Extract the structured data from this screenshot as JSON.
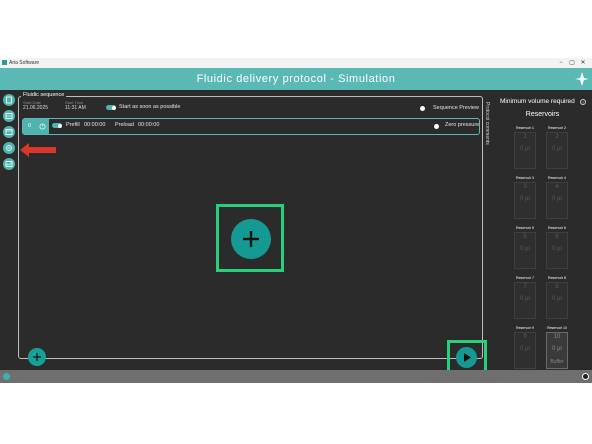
{
  "window": {
    "app_title": "Aria Software",
    "minimize_glyph": "−",
    "maximize_glyph": "▢",
    "close_glyph": "✕"
  },
  "header": {
    "title": "Fluidic delivery protocol - Simulation",
    "brand_icon": "aria-logo-icon"
  },
  "sidebar": {
    "icons": [
      "protocol-icon",
      "layers-icon",
      "calendar-icon",
      "settings-icon",
      "chart-icon"
    ]
  },
  "sequence": {
    "legend": "Fluidic sequence",
    "start_date_label": "Start Date",
    "start_date": "21.06.2025",
    "start_time_label": "Start Time",
    "start_time": "11:31 AM",
    "start_asap": "Start as soon as possible",
    "sequence_preview": "Sequence Preview",
    "row": {
      "number": "0",
      "prefill_label": "Prefill",
      "prefill_time": "00:00:00",
      "preload_label": "Preload",
      "preload_time": "00:00:00",
      "zero_pressure": "Zero pressure"
    },
    "add_glyph": "+",
    "play_glyph": "▶"
  },
  "side_tab": {
    "label": "Protocol comments"
  },
  "right_panel": {
    "min_volume_label": "Minimum volume required",
    "info_glyph": "?",
    "reservoirs_title": "Reservoirs",
    "reservoirs": [
      {
        "name": "Reservoir 1",
        "number": "1",
        "volume": "0 µl",
        "sub": ""
      },
      {
        "name": "Reservoir 2",
        "number": "2",
        "volume": "0 µl",
        "sub": ""
      },
      {
        "name": "Reservoir 3",
        "number": "3",
        "volume": "0 µl",
        "sub": ""
      },
      {
        "name": "Reservoir 4",
        "number": "4",
        "volume": "0 µl",
        "sub": ""
      },
      {
        "name": "Reservoir 5",
        "number": "5",
        "volume": "0 µl",
        "sub": ""
      },
      {
        "name": "Reservoir 6",
        "number": "6",
        "volume": "0 µl",
        "sub": ""
      },
      {
        "name": "Reservoir 7",
        "number": "7",
        "volume": "0 µl",
        "sub": ""
      },
      {
        "name": "Reservoir 8",
        "number": "8",
        "volume": "0 µl",
        "sub": ""
      },
      {
        "name": "Reservoir 9",
        "number": "9",
        "volume": "0 µl",
        "sub": ""
      },
      {
        "name": "Reservoir 10",
        "number": "10",
        "volume": "0 µl",
        "sub": "Buffer"
      }
    ]
  },
  "colors": {
    "accent": "#5bb9b5",
    "highlight": "#27d07a",
    "arrow": "#d9372a",
    "background": "#2b2b2b"
  }
}
